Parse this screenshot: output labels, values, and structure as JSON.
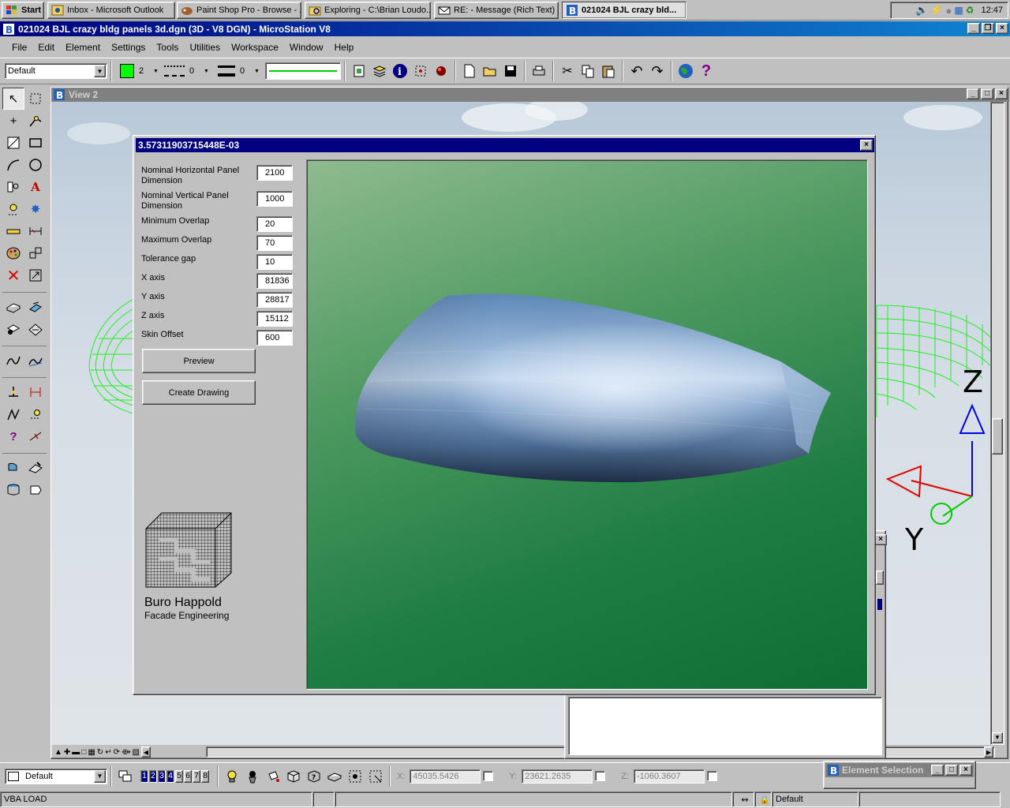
{
  "taskbar": {
    "start_label": "Start",
    "buttons": [
      {
        "label": "Inbox - Microsoft Outlook"
      },
      {
        "label": "Paint Shop Pro - Browse - ..."
      },
      {
        "label": "Exploring - C:\\Brian Loudo..."
      },
      {
        "label": "RE:  - Message (Rich Text)"
      },
      {
        "label": "021024 BJL crazy bld..."
      }
    ],
    "clock": "12:47"
  },
  "app": {
    "title": "021024 BJL crazy bldg panels 3d.dgn (3D - V8 DGN) - MicroStation V8",
    "menus": [
      {
        "label": "File"
      },
      {
        "label": "Edit"
      },
      {
        "label": "Element"
      },
      {
        "label": "Settings"
      },
      {
        "label": "Tools"
      },
      {
        "label": "Utilities"
      },
      {
        "label": "Workspace"
      },
      {
        "label": "Window"
      },
      {
        "label": "Help"
      }
    ]
  },
  "toolbar": {
    "level_combo": "Default",
    "color_swatch": "#00ff00",
    "color_value": "2",
    "style_value": "0",
    "weight_value": "0",
    "line_color": "#00cc00"
  },
  "view": {
    "title": "View 2",
    "axis_z": "Z",
    "axis_y": "Y"
  },
  "dialog": {
    "title": "3.57311903715448E-03",
    "fields": [
      {
        "label": "Nominal Horizontal Panel Dimension",
        "value": "2100"
      },
      {
        "label": "Nominal Vertical Panel Dimension",
        "value": "1000"
      },
      {
        "label": "Minimum Overlap",
        "value": "20"
      },
      {
        "label": "Maximum Overlap",
        "value": "70"
      },
      {
        "label": "Tolerance gap",
        "value": "10"
      },
      {
        "label": "X axis",
        "value": "81836"
      },
      {
        "label": "Y axis",
        "value": "28817"
      },
      {
        "label": "Z axis",
        "value": "15112"
      },
      {
        "label": "Skin Offset",
        "value": "600"
      }
    ],
    "preview_button": "Preview",
    "create_button": "Create Drawing",
    "logo_line1": "Buro Happold",
    "logo_line2": "Facade Engineering"
  },
  "bottom": {
    "level_combo": "Default",
    "views": [
      "1",
      "2",
      "3",
      "4",
      "5",
      "6",
      "7",
      "8"
    ],
    "x_label": "X:",
    "x_value": "45035.5426",
    "y_label": "Y:",
    "y_value": "23621.2635",
    "z_label": "Z:",
    "z_value": "-1060.3607",
    "element_selection_title": "Element Selection"
  },
  "status": {
    "message": "VBA LOAD",
    "level": "Default"
  }
}
